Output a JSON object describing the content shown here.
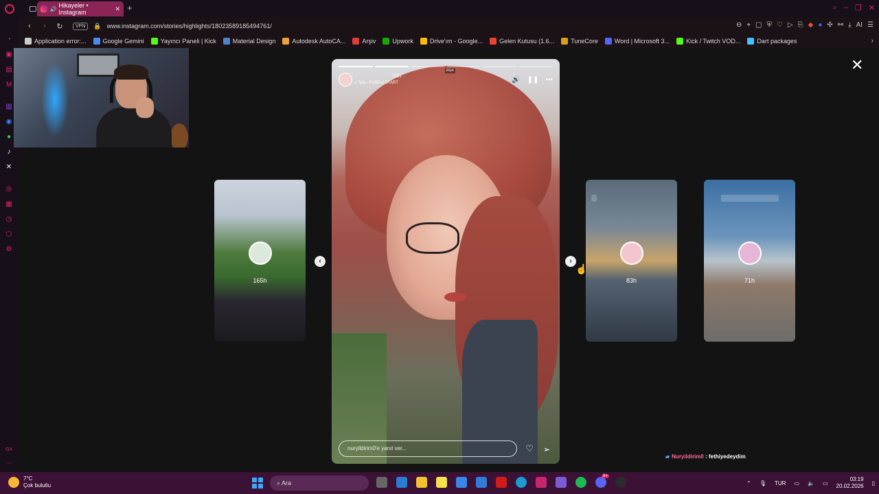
{
  "browser": {
    "tab_title": "Hikayeler • Instagram",
    "vpn_label": "VPN",
    "url": "www.instagram.com/stories/highlights/18023589185494761/",
    "ai_label": "AI"
  },
  "bookmarks": [
    {
      "label": "Application error:...",
      "color": "#cccccc"
    },
    {
      "label": "Google Gemini",
      "color": "#4b8af5"
    },
    {
      "label": "Yayıncı Paneli | Kick",
      "color": "#53fc18"
    },
    {
      "label": "Material Design",
      "color": "#4f83cc"
    },
    {
      "label": "Autodesk AutoCA...",
      "color": "#e8a33c"
    },
    {
      "label": "Arşiv",
      "color": "#e03c3c"
    },
    {
      "label": "Upwork",
      "color": "#14a800"
    },
    {
      "label": "Drive'ım - Google...",
      "color": "#fbbc04"
    },
    {
      "label": "Gelen Kutusu (1.6...",
      "color": "#ea4335"
    },
    {
      "label": "TuneCore",
      "color": "#d8a21c"
    },
    {
      "label": "Word | Microsoft 3...",
      "color": "#5865f2"
    },
    {
      "label": "Kick / Twitch VOD...",
      "color": "#53fc18"
    },
    {
      "label": "Dart packages",
      "color": "#40c4ff"
    }
  ],
  "story": {
    "time_ago": "38h",
    "music": "Tyla - PUSH 2 START",
    "sticker_label": "RGX",
    "reply_placeholder": "nuryildirim0'e yanıt ver..."
  },
  "previews": {
    "left_age": "165h",
    "mid_age": "83h",
    "right_age": "71h"
  },
  "chat": {
    "user": "Nuryildirim0",
    "separator": " : ",
    "message": "fethiyedeydim"
  },
  "taskbar": {
    "temperature": "7°C",
    "weather": "Çok bulutlu",
    "search_label": "Ara",
    "language": "TUR",
    "time": "03:19",
    "date": "20.02.2026",
    "badge": "8+"
  },
  "colors": {
    "opera_red": "#e0245e",
    "tab_active": "#8a2555",
    "taskbar": "#3b1136"
  }
}
